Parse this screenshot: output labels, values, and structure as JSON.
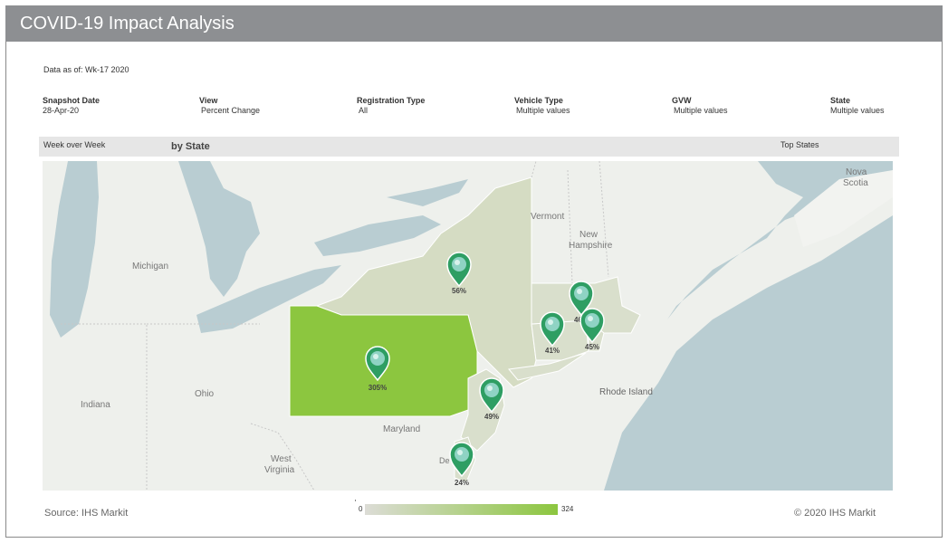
{
  "title": "COVID-19 Impact Analysis",
  "data_as_of": "Data as of: Wk-17 2020",
  "filters": [
    {
      "label": "Snapshot Date",
      "value": "28-Apr-20"
    },
    {
      "label": "View",
      "value": "Percent Change"
    },
    {
      "label": "Registration Type",
      "value": "All"
    },
    {
      "label": "Vehicle Type",
      "value": "Multiple values"
    },
    {
      "label": "GVW",
      "value": "Multiple values"
    },
    {
      "label": "State",
      "value": "Multiple values"
    }
  ],
  "band": {
    "left": "Week over Week",
    "middle": "by State",
    "right": "Top States"
  },
  "map_labels": {
    "michigan": "Michigan",
    "ohio": "Ohio",
    "indiana": "Indiana",
    "west_virginia_1": "West",
    "west_virginia_2": "Virginia",
    "maryland": "Maryland",
    "vermont": "Vermont",
    "new_hampshire_1": "New",
    "new_hampshire_2": "Hampshire",
    "rhode_island": "Rhode Island",
    "nova_scotia_1": "Nova",
    "nova_scotia_2": "Scotia",
    "delaware": "De"
  },
  "markers": [
    {
      "state": "NY",
      "value": "56%"
    },
    {
      "state": "PA",
      "value": "305%"
    },
    {
      "state": "MA",
      "value": "46%"
    },
    {
      "state": "CT",
      "value": "41%"
    },
    {
      "state": "RI",
      "value": "45%"
    },
    {
      "state": "NJ",
      "value": "49%"
    },
    {
      "state": "DE",
      "value": "24%"
    }
  ],
  "legend": {
    "min": "0",
    "max": "324",
    "color_low": "#dcdcd6",
    "color_high": "#8cc63f"
  },
  "footer": {
    "source": "Source: IHS Markit",
    "copyright": "© 2020 IHS Markit"
  },
  "colors": {
    "water": "#b9cdd2",
    "land": "#eef0ec",
    "pa": "#8cc63f",
    "ny": "#d5dcc3",
    "other_states": "#d9dfcc",
    "marker": "#2e9e63"
  }
}
